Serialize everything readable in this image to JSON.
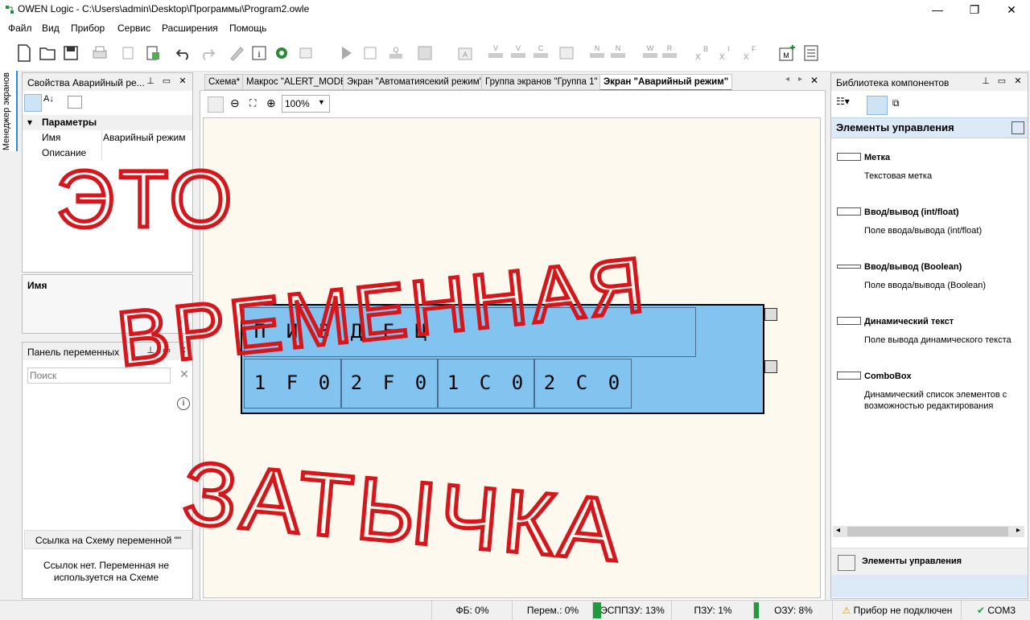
{
  "window": {
    "title": "OWEN Logic - C:\\Users\\admin\\Desktop\\Программы\\Program2.owle",
    "controls": [
      "—",
      "❐",
      "✕"
    ]
  },
  "menu": [
    "Файл",
    "Вид",
    "Прибор",
    "Сервис",
    "Расширения",
    "Помощь"
  ],
  "side_tab": {
    "label": "Менеджер экранов"
  },
  "properties_panel": {
    "title": "Свойства Аварийный ре...",
    "section": "Параметры",
    "rows": [
      {
        "key": "Имя",
        "value": "Аварийный режим"
      },
      {
        "key": "Описание",
        "value": ""
      }
    ],
    "footer_label": "Имя"
  },
  "variables_panel": {
    "title": "Панель переменных",
    "search_placeholder": "Поиск",
    "link_header": "Ссылка на Схему переменной \"\"",
    "link_text": "Ссылок нет. Переменная не используется на Схеме"
  },
  "tabs": [
    {
      "label": "Схема*"
    },
    {
      "label": "Макрос \"ALERT_MODE\""
    },
    {
      "label": "Экран \"Автоматиясекий режим\""
    },
    {
      "label": "Группа экранов \"Группа 1\""
    },
    {
      "label": "Экран \"Аварийный режим\"",
      "active": true
    }
  ],
  "tab_nav": [
    "◂",
    "▸",
    "✕"
  ],
  "editor_toolbar": {
    "zoom": "100%"
  },
  "lcd": {
    "rows": [
      [
        "П",
        "И",
        "З",
        "Д",
        "Е",
        "Ц"
      ],
      [
        "1",
        "F",
        "0",
        "2",
        "F",
        "0",
        "1",
        "C",
        "0",
        "2",
        "C",
        "0"
      ]
    ]
  },
  "library_panel": {
    "title": "Библиотека компонентов",
    "category": "Элементы управления",
    "items": [
      {
        "name": "Метка",
        "desc": "Текстовая метка"
      },
      {
        "name": "Ввод/вывод (int/float)",
        "desc": "Поле ввода/вывода (int/float)"
      },
      {
        "name": "Ввод/вывод (Boolean)",
        "desc": "Поле ввода/вывода (Boolean)"
      },
      {
        "name": "Динамический текст",
        "desc": "Поле вывода динамического текста"
      },
      {
        "name": "ComboBox",
        "desc": "Динамический список элементов с возможностью редактирования"
      }
    ],
    "footer": "Элементы управления"
  },
  "status": {
    "fb": "ФБ: 0%",
    "vars": "Перем.: 0%",
    "eeprom": "ЭСППЗУ: 13%",
    "rom": "ПЗУ: 1%",
    "ram": "ОЗУ: 8%",
    "device": "Прибор не подключен",
    "port": "COM3"
  },
  "overlay": {
    "line1": "ЭТО",
    "line2": "ВРЕМЕННАЯ",
    "line3": "ЗАТЫЧКА"
  },
  "colors": {
    "accent": "#2f8ad6",
    "lcd": "#83c3f0",
    "canvas": "#fdf9ef",
    "overlay": "#d4161d"
  }
}
